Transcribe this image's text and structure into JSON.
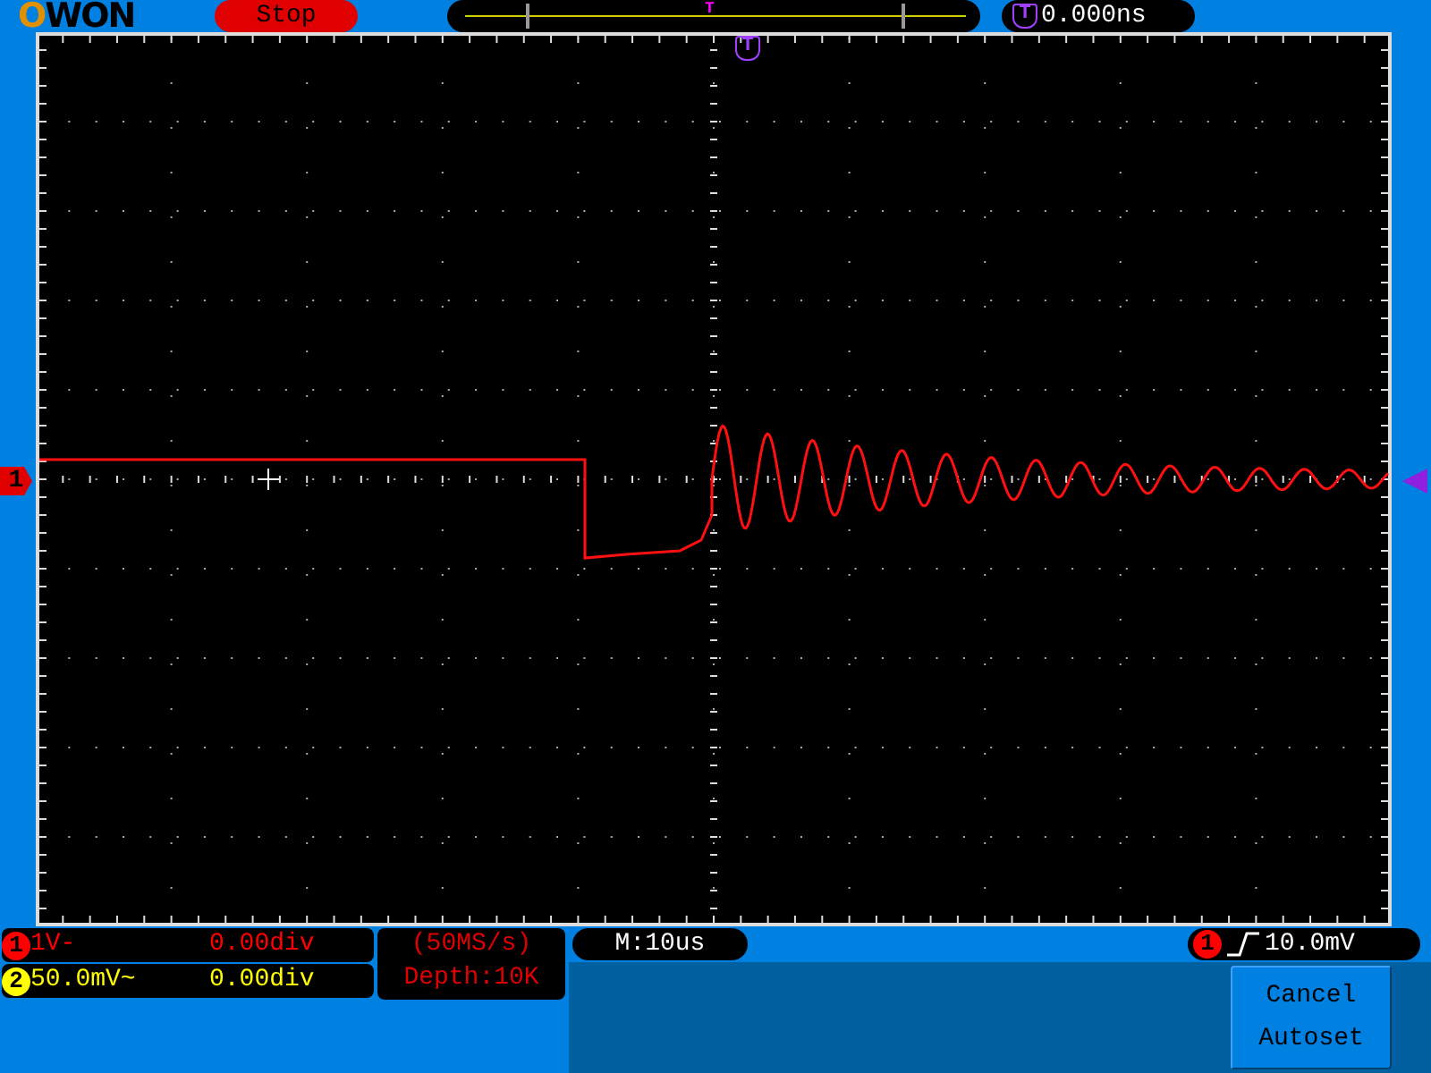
{
  "brand": "OWON",
  "run_state": "Stop",
  "trigger_position": {
    "marker": "T"
  },
  "trigger_time": {
    "icon": "T",
    "value": "0.000ns"
  },
  "grid_trigger_marker": "T",
  "trace_marker": "1",
  "channels": [
    {
      "badge": "1",
      "scale": "1V-",
      "offset": "0.00div",
      "color": "#ff0000"
    },
    {
      "badge": "2",
      "scale": "50.0mV~",
      "offset": "0.00div",
      "color": "#ffff00"
    }
  ],
  "sample": {
    "rate": "(50MS/s)",
    "depth": "Depth:10K"
  },
  "timebase": "M:10us",
  "trigger": {
    "source": "1",
    "level": "10.0mV"
  },
  "softkeys": [
    {
      "lines": [
        "Cancel",
        "Autoset"
      ]
    }
  ]
}
